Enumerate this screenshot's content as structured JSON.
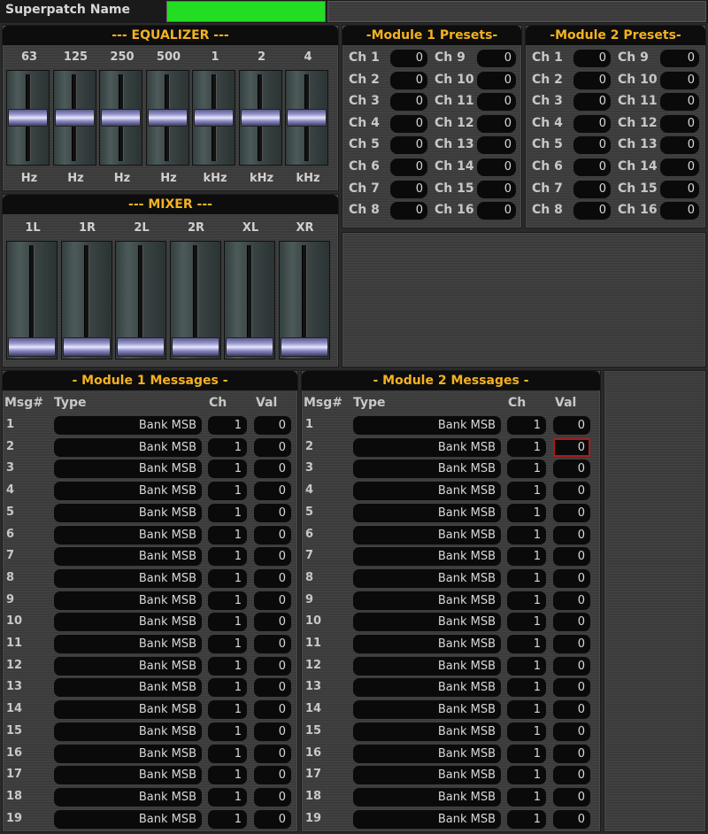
{
  "superpatch": {
    "label": "Superpatch Name",
    "name": "",
    "field_color": "#22dd22"
  },
  "equalizer": {
    "title": "--- EQUALIZER ---",
    "bands": [
      {
        "freq": "63",
        "unit": "Hz",
        "level": 0.5
      },
      {
        "freq": "125",
        "unit": "Hz",
        "level": 0.5
      },
      {
        "freq": "250",
        "unit": "Hz",
        "level": 0.5
      },
      {
        "freq": "500",
        "unit": "Hz",
        "level": 0.5
      },
      {
        "freq": "1",
        "unit": "kHz",
        "level": 0.5
      },
      {
        "freq": "2",
        "unit": "kHz",
        "level": 0.5
      },
      {
        "freq": "4",
        "unit": "kHz",
        "level": 0.5
      }
    ]
  },
  "mixer": {
    "title": "--- MIXER ---",
    "channels": [
      {
        "label": "1L",
        "level": 0.0
      },
      {
        "label": "1R",
        "level": 0.0
      },
      {
        "label": "2L",
        "level": 0.0
      },
      {
        "label": "2R",
        "level": 0.0
      },
      {
        "label": "XL",
        "level": 0.0
      },
      {
        "label": "XR",
        "level": 0.0
      }
    ]
  },
  "module1_presets": {
    "title": "-Module 1 Presets-",
    "channels": [
      {
        "label": "Ch 1",
        "value": "0"
      },
      {
        "label": "Ch 2",
        "value": "0"
      },
      {
        "label": "Ch 3",
        "value": "0"
      },
      {
        "label": "Ch 4",
        "value": "0"
      },
      {
        "label": "Ch 5",
        "value": "0"
      },
      {
        "label": "Ch 6",
        "value": "0"
      },
      {
        "label": "Ch 7",
        "value": "0"
      },
      {
        "label": "Ch 8",
        "value": "0"
      },
      {
        "label": "Ch 9",
        "value": "0"
      },
      {
        "label": "Ch 10",
        "value": "0"
      },
      {
        "label": "Ch 11",
        "value": "0"
      },
      {
        "label": "Ch 12",
        "value": "0"
      },
      {
        "label": "Ch 13",
        "value": "0"
      },
      {
        "label": "Ch 14",
        "value": "0"
      },
      {
        "label": "Ch 15",
        "value": "0"
      },
      {
        "label": "Ch 16",
        "value": "0"
      }
    ]
  },
  "module2_presets": {
    "title": "-Module 2 Presets-",
    "channels": [
      {
        "label": "Ch 1",
        "value": "0"
      },
      {
        "label": "Ch 2",
        "value": "0"
      },
      {
        "label": "Ch 3",
        "value": "0"
      },
      {
        "label": "Ch 4",
        "value": "0"
      },
      {
        "label": "Ch 5",
        "value": "0"
      },
      {
        "label": "Ch 6",
        "value": "0"
      },
      {
        "label": "Ch 7",
        "value": "0"
      },
      {
        "label": "Ch 8",
        "value": "0"
      },
      {
        "label": "Ch 9",
        "value": "0"
      },
      {
        "label": "Ch 10",
        "value": "0"
      },
      {
        "label": "Ch 11",
        "value": "0"
      },
      {
        "label": "Ch 12",
        "value": "0"
      },
      {
        "label": "Ch 13",
        "value": "0"
      },
      {
        "label": "Ch 14",
        "value": "0"
      },
      {
        "label": "Ch 15",
        "value": "0"
      },
      {
        "label": "Ch 16",
        "value": "0"
      }
    ]
  },
  "module1_messages": {
    "title": "- Module 1 Messages -",
    "headers": {
      "msg": "Msg#",
      "type": "Type",
      "ch": "Ch",
      "val": "Val"
    },
    "rows": [
      {
        "num": "1",
        "type": "Bank MSB",
        "ch": "1",
        "val": "0"
      },
      {
        "num": "2",
        "type": "Bank MSB",
        "ch": "1",
        "val": "0"
      },
      {
        "num": "3",
        "type": "Bank MSB",
        "ch": "1",
        "val": "0"
      },
      {
        "num": "4",
        "type": "Bank MSB",
        "ch": "1",
        "val": "0"
      },
      {
        "num": "5",
        "type": "Bank MSB",
        "ch": "1",
        "val": "0"
      },
      {
        "num": "6",
        "type": "Bank MSB",
        "ch": "1",
        "val": "0"
      },
      {
        "num": "7",
        "type": "Bank MSB",
        "ch": "1",
        "val": "0"
      },
      {
        "num": "8",
        "type": "Bank MSB",
        "ch": "1",
        "val": "0"
      },
      {
        "num": "9",
        "type": "Bank MSB",
        "ch": "1",
        "val": "0"
      },
      {
        "num": "10",
        "type": "Bank MSB",
        "ch": "1",
        "val": "0"
      },
      {
        "num": "11",
        "type": "Bank MSB",
        "ch": "1",
        "val": "0"
      },
      {
        "num": "12",
        "type": "Bank MSB",
        "ch": "1",
        "val": "0"
      },
      {
        "num": "13",
        "type": "Bank MSB",
        "ch": "1",
        "val": "0"
      },
      {
        "num": "14",
        "type": "Bank MSB",
        "ch": "1",
        "val": "0"
      },
      {
        "num": "15",
        "type": "Bank MSB",
        "ch": "1",
        "val": "0"
      },
      {
        "num": "16",
        "type": "Bank MSB",
        "ch": "1",
        "val": "0"
      },
      {
        "num": "17",
        "type": "Bank MSB",
        "ch": "1",
        "val": "0"
      },
      {
        "num": "18",
        "type": "Bank MSB",
        "ch": "1",
        "val": "0"
      },
      {
        "num": "19",
        "type": "Bank MSB",
        "ch": "1",
        "val": "0"
      }
    ]
  },
  "module2_messages": {
    "title": "- Module 2 Messages -",
    "headers": {
      "msg": "Msg#",
      "type": "Type",
      "ch": "Ch",
      "val": "Val"
    },
    "selected_row": 1,
    "rows": [
      {
        "num": "1",
        "type": "Bank MSB",
        "ch": "1",
        "val": "0"
      },
      {
        "num": "2",
        "type": "Bank MSB",
        "ch": "1",
        "val": "0"
      },
      {
        "num": "3",
        "type": "Bank MSB",
        "ch": "1",
        "val": "0"
      },
      {
        "num": "4",
        "type": "Bank MSB",
        "ch": "1",
        "val": "0"
      },
      {
        "num": "5",
        "type": "Bank MSB",
        "ch": "1",
        "val": "0"
      },
      {
        "num": "6",
        "type": "Bank MSB",
        "ch": "1",
        "val": "0"
      },
      {
        "num": "7",
        "type": "Bank MSB",
        "ch": "1",
        "val": "0"
      },
      {
        "num": "8",
        "type": "Bank MSB",
        "ch": "1",
        "val": "0"
      },
      {
        "num": "9",
        "type": "Bank MSB",
        "ch": "1",
        "val": "0"
      },
      {
        "num": "10",
        "type": "Bank MSB",
        "ch": "1",
        "val": "0"
      },
      {
        "num": "11",
        "type": "Bank MSB",
        "ch": "1",
        "val": "0"
      },
      {
        "num": "12",
        "type": "Bank MSB",
        "ch": "1",
        "val": "0"
      },
      {
        "num": "13",
        "type": "Bank MSB",
        "ch": "1",
        "val": "0"
      },
      {
        "num": "14",
        "type": "Bank MSB",
        "ch": "1",
        "val": "0"
      },
      {
        "num": "15",
        "type": "Bank MSB",
        "ch": "1",
        "val": "0"
      },
      {
        "num": "16",
        "type": "Bank MSB",
        "ch": "1",
        "val": "0"
      },
      {
        "num": "17",
        "type": "Bank MSB",
        "ch": "1",
        "val": "0"
      },
      {
        "num": "18",
        "type": "Bank MSB",
        "ch": "1",
        "val": "0"
      },
      {
        "num": "19",
        "type": "Bank MSB",
        "ch": "1",
        "val": "0"
      }
    ]
  },
  "colors": {
    "accent": "#f5b21f",
    "selected": "#b01818"
  }
}
